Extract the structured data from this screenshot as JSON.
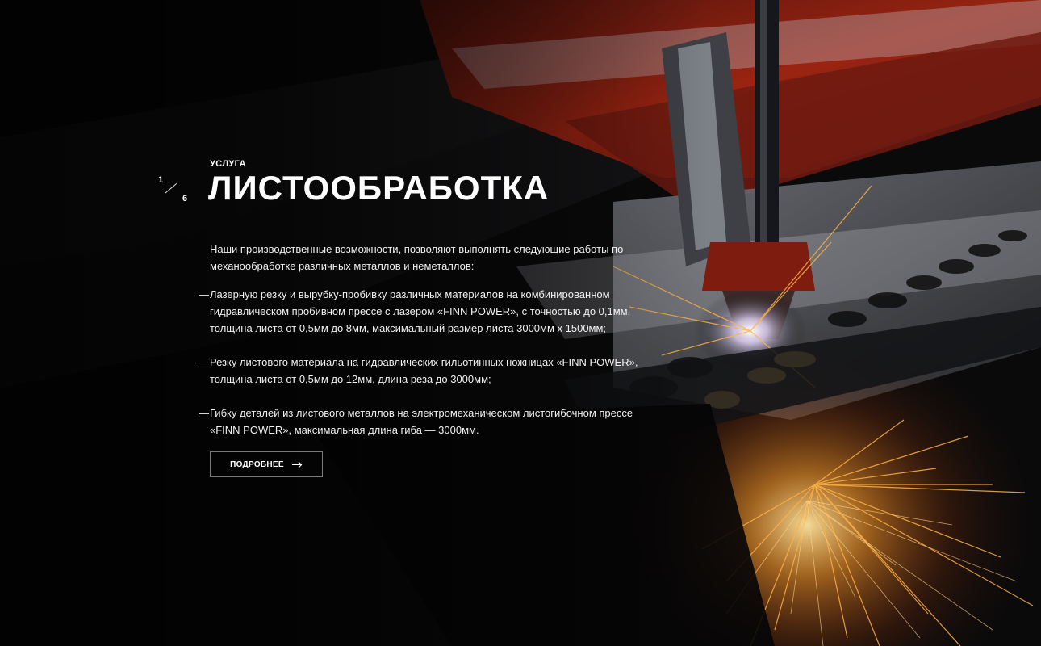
{
  "slider": {
    "current": "1",
    "total": "6"
  },
  "service": {
    "eyebrow": "УСЛУГА",
    "title": "ЛИСТООБРАБОТКА",
    "intro": "Наши производственные возможности, позволяют выполнять следующие работы по механообработке различных металлов и неметаллов:",
    "items": [
      {
        "marker": "—",
        "text": "Лазерную резку и вырубку-пробивку различных материалов на комбинированном гидравлическом пробивном прессе с лазером «FINN POWER», с точностью до 0,1мм, толщина листа от 0,5мм до 8мм, максимальный размер листа 3000мм х 1500мм;"
      },
      {
        "marker": "—",
        "text": "Резку листового материала на гидравлических гильотинных ножницах «FINN POWER», толщина листа от 0,5мм до 12мм, длина реза до 3000мм;"
      },
      {
        "marker": "—",
        "text": "Гибку деталей из листового металлов на электромеханическом листогибочном прессе «FINN POWER», максимальная длина гиба — 3000мм."
      }
    ],
    "more_label": "ПОДРОБНЕЕ",
    "more_icon": "arrow-right-icon"
  },
  "colors": {
    "background": "#050505",
    "machine_red": "#8e1a0e",
    "sparks": "#ffb040"
  }
}
